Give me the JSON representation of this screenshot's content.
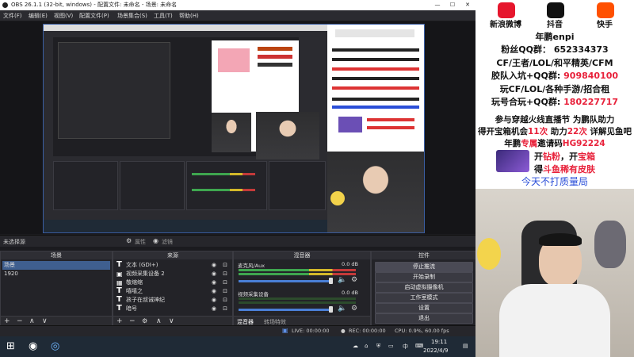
{
  "window": {
    "title": "OBS 26.1.1 (32-bit, windows) - 配置文件: 未命名 - 场景: 未命名",
    "minimize": "—",
    "maximize": "☐",
    "close": "✕"
  },
  "menu": [
    "文件(F)",
    "编辑(E)",
    "视图(V)",
    "配置文件(P)",
    "场景集合(S)",
    "工具(T)",
    "帮助(H)"
  ],
  "source_bar": {
    "label": "未选择源",
    "properties": "属性",
    "filters": "滤镜"
  },
  "scenes": {
    "title": "场景",
    "items": [
      "场景",
      "1920"
    ]
  },
  "sources": {
    "title": "来源",
    "items": [
      "文本 (GDI+)",
      "视频采集设备 2",
      "敬缩缩",
      "嘻嘻之",
      "孩子在叔诫神纪",
      "暗号"
    ]
  },
  "mixer": {
    "title": "混音器",
    "channels": [
      {
        "name": "麦克风/Aux",
        "db": "0.0 dB"
      },
      {
        "name": "视频采集设备",
        "db": "0.0 dB"
      }
    ],
    "tabs": [
      "混音器",
      "转场特效"
    ]
  },
  "controls": {
    "title": "控件",
    "buttons": [
      "停止推流",
      "开始录制",
      "启动虚拟摄像机",
      "工作室模式",
      "设置",
      "退出"
    ]
  },
  "status": {
    "live": "LIVE: 00:00:00",
    "rec": "REC: 00:00:00",
    "cpu": "CPU: 0.9%, 60.00 fps"
  },
  "taskbar": {
    "ime": "中",
    "time": "19:11",
    "date": "2022/4/9"
  },
  "overlay": {
    "social": [
      {
        "label": "新浪微博",
        "icon": "weibo-icon",
        "color": "#e6162d"
      },
      {
        "label": "抖音",
        "icon": "douyin-icon",
        "color": "#111111"
      },
      {
        "label": "快手",
        "icon": "kuaishou-icon",
        "color": "#ff5000"
      }
    ],
    "streamer": "年鹏enpi",
    "fans_qq": "粉丝QQ群： 652334373",
    "cf_line": "CF/王者/LOL/和平精英/CFM",
    "join_prefix": "胶队入坑+QQ群:",
    "join_num": "909840100",
    "play_line": "玩CF/LOL/各种手游/招合租",
    "partner_prefix": "玩号合玩+QQ群:",
    "partner_num": "180227717",
    "event_line1": "参与穿越火线直播节 为鹏队助力",
    "event_line2_a": "得开宝箱机会",
    "event_line2_b": "11次",
    "event_line2_c": " 助力",
    "event_line2_d": "22次",
    "event_line2_e": " 详解见鱼吧",
    "event_line3_a": "年鹏",
    "event_line3_b": "专属",
    "event_line3_c": "邀请码",
    "event_line3_d": "HG92224",
    "promo_line1_a": "开",
    "promo_line1_b": "钻粉",
    "promo_line1_c": "，开",
    "promo_line1_d": "宝箱",
    "promo_line2_a": "得",
    "promo_line2_b": "斗鱼稀有皮肤",
    "quality_note": "今天不打质量局"
  }
}
